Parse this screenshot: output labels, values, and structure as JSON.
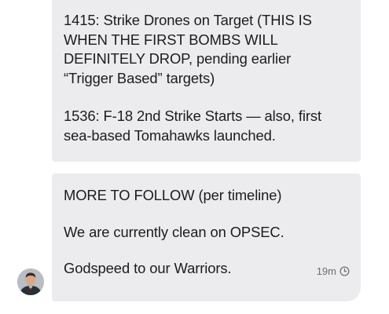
{
  "messages": [
    {
      "paragraphs": [
        [
          "1415: Strike Drones on Target (THIS IS",
          "WHEN THE FIRST BOMBS WILL",
          "DEFINITELY DROP, pending earlier",
          "“Trigger Based” targets)"
        ],
        [
          "1536: F-18 2nd Strike Starts — also, first",
          "sea-based Tomahawks launched."
        ]
      ]
    },
    {
      "paragraphs": [
        [
          "MORE TO FOLLOW (per timeline)"
        ],
        [
          "We are currently clean on OPSEC."
        ],
        [
          "Godspeed to our Warriors."
        ]
      ],
      "timestamp": "19m",
      "timestamp_icon": "clock-icon"
    }
  ],
  "sender": {
    "avatar_icon": "avatar"
  },
  "colors": {
    "bubble_background": "#ececee",
    "text": "#1c1c1e",
    "timestamp": "#6e6e73"
  }
}
